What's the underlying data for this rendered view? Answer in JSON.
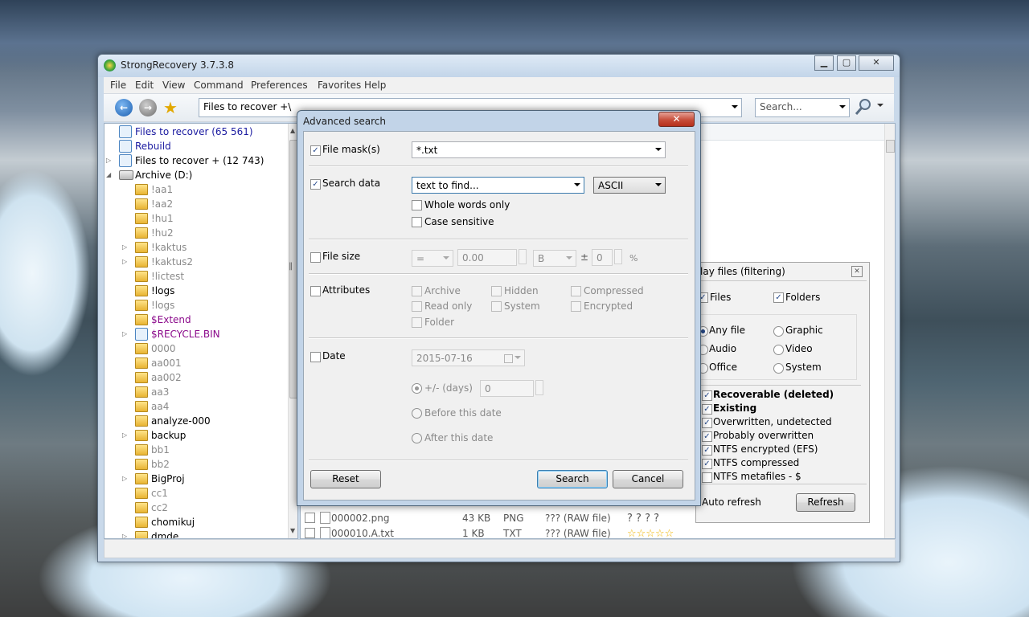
{
  "app": {
    "title": "StrongRecovery 3.7.3.8",
    "menu": [
      "File",
      "Edit",
      "View",
      "Command",
      "Preferences",
      "Favorites",
      "Help"
    ],
    "path": "Files to recover +\\",
    "search_placeholder": "Search..."
  },
  "tree": [
    {
      "label": "Files to recover (65 561)",
      "color": "#1a1aa0",
      "indent": 0,
      "icon": "recover-icon"
    },
    {
      "label": "Rebuild",
      "color": "#1a1aa0",
      "indent": 0,
      "icon": "recover-icon"
    },
    {
      "label": "Files to recover + (12 743)",
      "color": "#000000",
      "indent": 0,
      "icon": "recover-icon",
      "expander": true
    },
    {
      "label": "Archive (D:)",
      "color": "#000000",
      "indent": 0,
      "icon": "drive-icon",
      "expanded": true
    },
    {
      "label": "!aa1",
      "color": "#8a8a8a",
      "indent": 1,
      "icon": "folder-icon"
    },
    {
      "label": "!aa2",
      "color": "#8a8a8a",
      "indent": 1,
      "icon": "folder-icon"
    },
    {
      "label": "!hu1",
      "color": "#8a8a8a",
      "indent": 1,
      "icon": "folder-icon"
    },
    {
      "label": "!hu2",
      "color": "#8a8a8a",
      "indent": 1,
      "icon": "folder-icon"
    },
    {
      "label": "!kaktus",
      "color": "#8a8a8a",
      "indent": 1,
      "icon": "folder-icon",
      "expander": true
    },
    {
      "label": "!kaktus2",
      "color": "#8a8a8a",
      "indent": 1,
      "icon": "folder-icon",
      "expander": true
    },
    {
      "label": "!lictest",
      "color": "#8a8a8a",
      "indent": 1,
      "icon": "folder-icon"
    },
    {
      "label": "!logs",
      "color": "#000000",
      "indent": 1,
      "icon": "folder-icon"
    },
    {
      "label": "!logs",
      "color": "#8a8a8a",
      "indent": 1,
      "icon": "folder-icon"
    },
    {
      "label": "$Extend",
      "color": "#8b0a8b",
      "indent": 1,
      "icon": "folder-icon"
    },
    {
      "label": "$RECYCLE.BIN",
      "color": "#8b0a8b",
      "indent": 1,
      "icon": "recycle-icon",
      "expander": true
    },
    {
      "label": "0000",
      "color": "#8a8a8a",
      "indent": 1,
      "icon": "folder-icon"
    },
    {
      "label": "aa001",
      "color": "#8a8a8a",
      "indent": 1,
      "icon": "folder-icon"
    },
    {
      "label": "aa002",
      "color": "#8a8a8a",
      "indent": 1,
      "icon": "folder-icon"
    },
    {
      "label": "aa3",
      "color": "#8a8a8a",
      "indent": 1,
      "icon": "folder-icon"
    },
    {
      "label": "aa4",
      "color": "#8a8a8a",
      "indent": 1,
      "icon": "folder-icon"
    },
    {
      "label": "analyze-000",
      "color": "#000000",
      "indent": 1,
      "icon": "folder-icon"
    },
    {
      "label": "backup",
      "color": "#000000",
      "indent": 1,
      "icon": "folder-icon",
      "expander": true
    },
    {
      "label": "bb1",
      "color": "#8a8a8a",
      "indent": 1,
      "icon": "folder-icon"
    },
    {
      "label": "bb2",
      "color": "#8a8a8a",
      "indent": 1,
      "icon": "folder-icon"
    },
    {
      "label": "BigProj",
      "color": "#000000",
      "indent": 1,
      "icon": "folder-icon",
      "expander": true
    },
    {
      "label": "cc1",
      "color": "#8a8a8a",
      "indent": 1,
      "icon": "folder-icon"
    },
    {
      "label": "cc2",
      "color": "#8a8a8a",
      "indent": 1,
      "icon": "folder-icon"
    },
    {
      "label": "chomikuj",
      "color": "#000000",
      "indent": 1,
      "icon": "folder-icon"
    },
    {
      "label": "dmde",
      "color": "#000000",
      "indent": 1,
      "icon": "folder-icon",
      "expander": true
    }
  ],
  "files": [
    {
      "name": "000002.png",
      "size": "43 KB",
      "type": "PNG",
      "state": "??? (RAW file)",
      "rating": "? ? ? ?"
    },
    {
      "name": "000010.A.txt",
      "size": "1 KB",
      "type": "TXT",
      "state": "??? (RAW file)",
      "rating": "☆☆☆☆☆"
    }
  ],
  "filter": {
    "title": "lay files (filtering)",
    "files_label": "Files",
    "folders_label": "Folders",
    "types": [
      "Any file",
      "Graphic",
      "Audio",
      "Video",
      "Office",
      "System"
    ],
    "states": [
      {
        "label": "Recoverable (deleted)",
        "bold": true
      },
      {
        "label": "Existing",
        "bold": true
      },
      {
        "label": "Overwritten, undetected",
        "bold": false
      },
      {
        "label": "Probably overwritten",
        "bold": false
      },
      {
        "label": "NTFS encrypted (EFS)",
        "bold": false
      },
      {
        "label": "NTFS compressed",
        "bold": false
      },
      {
        "label": "NTFS metafiles - $",
        "bold": false
      }
    ],
    "auto_refresh": "Auto refresh",
    "refresh": "Refresh"
  },
  "dialog": {
    "title": "Advanced search",
    "close": "✕",
    "file_mask_label": "File mask(s)",
    "file_mask_value": "*.txt",
    "search_data_label": "Search data",
    "search_data_value": "text to find...",
    "encoding": "ASCII",
    "whole_words": "Whole words only",
    "case_sensitive": "Case sensitive",
    "file_size_label": "File size",
    "size_op": "=",
    "size_value": "0.00",
    "size_unit": "B",
    "plusminus": "±",
    "tolerance": "0",
    "percent": "%",
    "attributes_label": "Attributes",
    "attributes": [
      "Archive",
      "Hidden",
      "Compressed",
      "Read only",
      "System",
      "Encrypted",
      "Folder"
    ],
    "date_label": "Date",
    "date_value": "2015-07-16",
    "days_label": "+/- (days)",
    "days_value": "0",
    "before_label": "Before this date",
    "after_label": "After this date",
    "reset": "Reset",
    "search": "Search",
    "cancel": "Cancel"
  }
}
